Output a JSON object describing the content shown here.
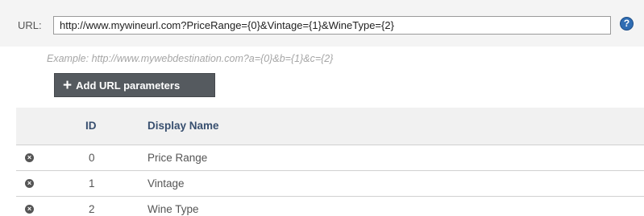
{
  "url_field": {
    "label": "URL:",
    "value": "http://www.mywineurl.com?PriceRange={0}&Vintage={1}&WineType={2}"
  },
  "help": {
    "glyph": "?",
    "icon": "help-icon",
    "color": "#2f6db3"
  },
  "example": "Example: http://www.mywebdestination.com?a={0}&b={1}&c={2}",
  "add_button": {
    "icon": "plus-icon",
    "label": "Add URL parameters"
  },
  "table": {
    "headers": {
      "id": "ID",
      "display_name": "Display Name"
    },
    "rows": [
      {
        "id": "0",
        "display_name": "Price Range"
      },
      {
        "id": "1",
        "display_name": "Vintage"
      },
      {
        "id": "2",
        "display_name": "Wine Type"
      }
    ],
    "remove_icon": "remove-icon"
  }
}
